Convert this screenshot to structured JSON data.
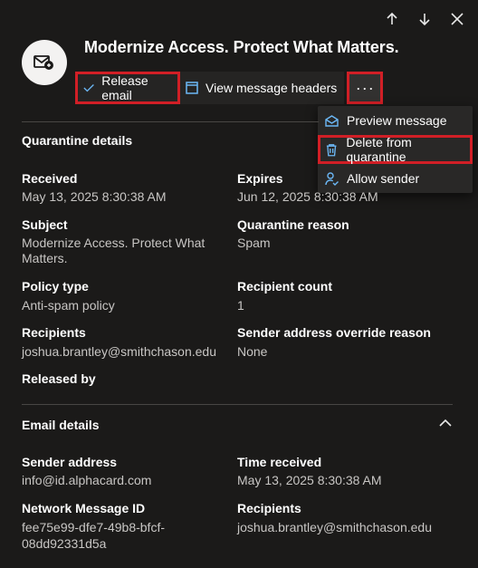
{
  "title": "Modernize Access. Protect What Matters.",
  "toolbar": {
    "release_label": "Release email",
    "headers_label": "View message headers",
    "more_label": "···"
  },
  "menu": {
    "preview": "Preview message",
    "delete": "Delete from quarantine",
    "allow": "Allow sender"
  },
  "quarantine": {
    "heading": "Quarantine details",
    "received_label": "Received",
    "received_value": "May 13, 2025 8:30:38 AM",
    "expires_label": "Expires",
    "expires_value": "Jun 12, 2025 8:30:38 AM",
    "subject_label": "Subject",
    "subject_line1": "Modernize Access. Protect What",
    "subject_line2": "Matters.",
    "reason_label": "Quarantine reason",
    "reason_value": "Spam",
    "policy_label": "Policy type",
    "policy_value": "Anti-spam policy",
    "count_label": "Recipient count",
    "count_value": "1",
    "recipients_label": "Recipients",
    "recipients_value": "joshua.brantley@smithchason.edu",
    "override_label": "Sender address override reason",
    "override_value": "None",
    "released_label": "Released by"
  },
  "email": {
    "heading": "Email details",
    "sender_label": "Sender address",
    "sender_value": "info@id.alphacard.com",
    "time_label": "Time received",
    "time_value": "May 13, 2025 8:30:38 AM",
    "netid_label": "Network Message ID",
    "netid_line1": "fee75e99-dfe7-49b8-bfcf-",
    "netid_line2": "08dd92331d5a",
    "recipients_label": "Recipients",
    "recipients_value": "joshua.brantley@smithchason.edu"
  }
}
